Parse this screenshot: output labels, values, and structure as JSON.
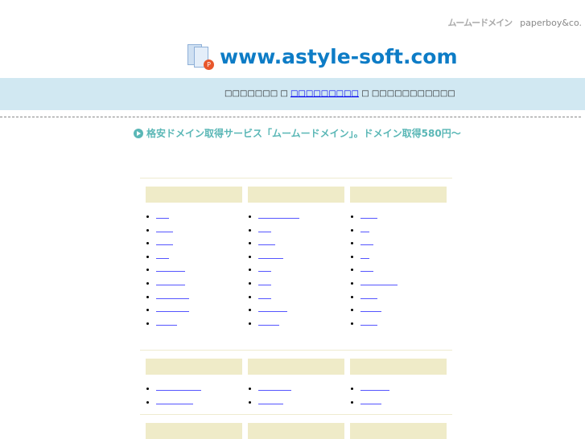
{
  "top_logos": {
    "muumuu": "ムームードメイン",
    "paperboy": "paperboy&co."
  },
  "header": {
    "domain": "www.astyle-soft.com",
    "badge": "P"
  },
  "bar": {
    "before": "□□□□□□□ □",
    "link": "□□□□□□□□□",
    "after": "□ □□□□□□□□□□□"
  },
  "promo": {
    "text": "格安ドメイン取得サービス「ムームードメイン」。ドメイン取得580円〜"
  },
  "sections": [
    {
      "columns": [
        {
          "links": [
            "",
            "",
            "",
            "",
            "",
            "",
            "",
            "",
            ""
          ]
        },
        {
          "links": [
            "",
            "",
            "",
            "",
            "",
            "",
            "",
            "",
            ""
          ]
        },
        {
          "links": [
            "",
            "",
            "",
            "",
            "",
            "",
            "",
            "",
            ""
          ]
        }
      ]
    },
    {
      "columns": [
        {
          "links": [
            "",
            ""
          ]
        },
        {
          "links": [
            "",
            ""
          ]
        },
        {
          "links": [
            "",
            ""
          ]
        }
      ]
    },
    {
      "columns": [
        {
          "links": []
        },
        {
          "links": []
        },
        {
          "links": []
        }
      ]
    }
  ]
}
